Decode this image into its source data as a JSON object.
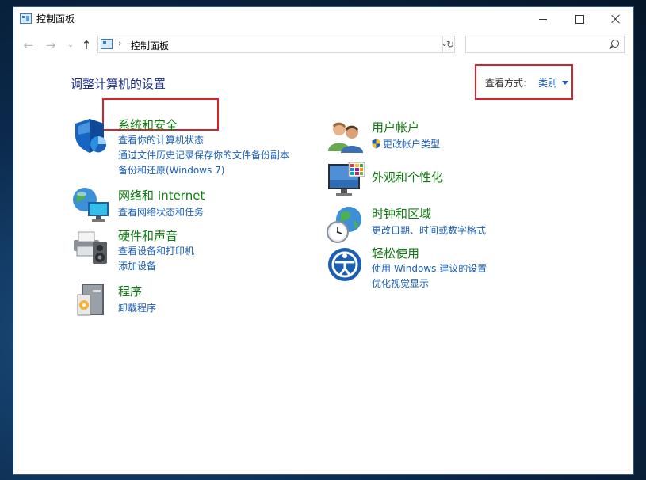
{
  "window": {
    "title": "控制面板"
  },
  "address": {
    "path": "控制面板",
    "search_placeholder": ""
  },
  "main": {
    "title": "调整计算机的设置",
    "view_by": {
      "label": "查看方式:",
      "value": "类别"
    }
  },
  "categories_left": [
    {
      "title": "系统和安全",
      "links": [
        "查看你的计算机状态",
        "通过文件历史记录保存你的文件备份副本",
        "备份和还原(Windows 7)"
      ]
    },
    {
      "title": "网络和 Internet",
      "links": [
        "查看网络状态和任务"
      ]
    },
    {
      "title": "硬件和声音",
      "links": [
        "查看设备和打印机",
        "添加设备"
      ]
    },
    {
      "title": "程序",
      "links": [
        "卸载程序"
      ]
    }
  ],
  "categories_right": [
    {
      "title": "用户帐户",
      "links": [
        "更改帐户类型"
      ]
    },
    {
      "title": "外观和个性化",
      "links": []
    },
    {
      "title": "时钟和区域",
      "links": [
        "更改日期、时间或数字格式"
      ]
    },
    {
      "title": "轻松使用",
      "links": [
        "使用 Windows 建议的设置",
        "优化视觉显示"
      ]
    }
  ],
  "colors": {
    "category_title": "#107c10",
    "link": "#1a5fb4",
    "page_title": "#1e3287",
    "highlight": "#d9202b"
  }
}
